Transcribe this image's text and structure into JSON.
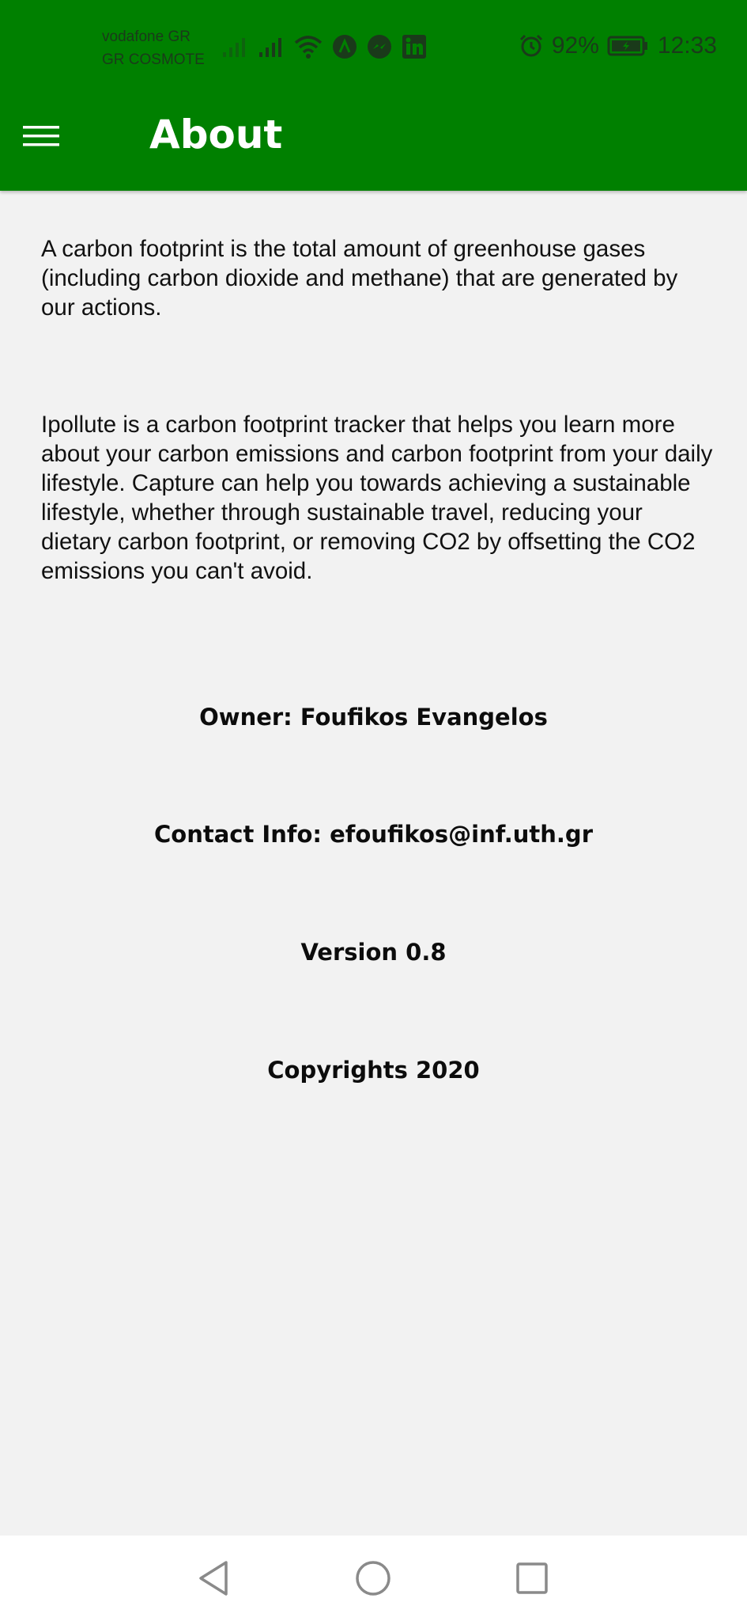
{
  "status_bar": {
    "carrier_1": "vodafone GR",
    "carrier_2": "GR COSMOTE",
    "battery_percent": "92%",
    "time": "12:33",
    "icons": [
      "signal-icon",
      "signal-icon",
      "wifi-icon",
      "app-notification-icon",
      "messenger-icon",
      "linkedin-icon",
      "alarm-icon",
      "battery-icon"
    ]
  },
  "app_bar": {
    "title": "About",
    "menu_icon": "hamburger-menu-icon",
    "background_color": "#008000"
  },
  "content": {
    "paragraph_1": "A carbon footprint is the total amount of greenhouse gases (including carbon dioxide and methane) that are generated by our actions.",
    "paragraph_2": "Ipollute is a carbon footprint tracker that helps you learn more about your carbon emissions and carbon footprint from your daily lifestyle. Capture can help you towards achieving a sustainable lifestyle, whether through sustainable travel, reducing your dietary carbon footprint, or removing CO2 by offsetting the CO2 emissions you can't avoid.",
    "owner": "Owner: Foufikos Evangelos",
    "contact": "Contact Info: efoufikos@inf.uth.gr",
    "version": "Version 0.8",
    "copyright": "Copyrights 2020"
  },
  "nav_bar": {
    "icons": [
      "back-icon",
      "home-icon",
      "recent-apps-icon"
    ]
  }
}
